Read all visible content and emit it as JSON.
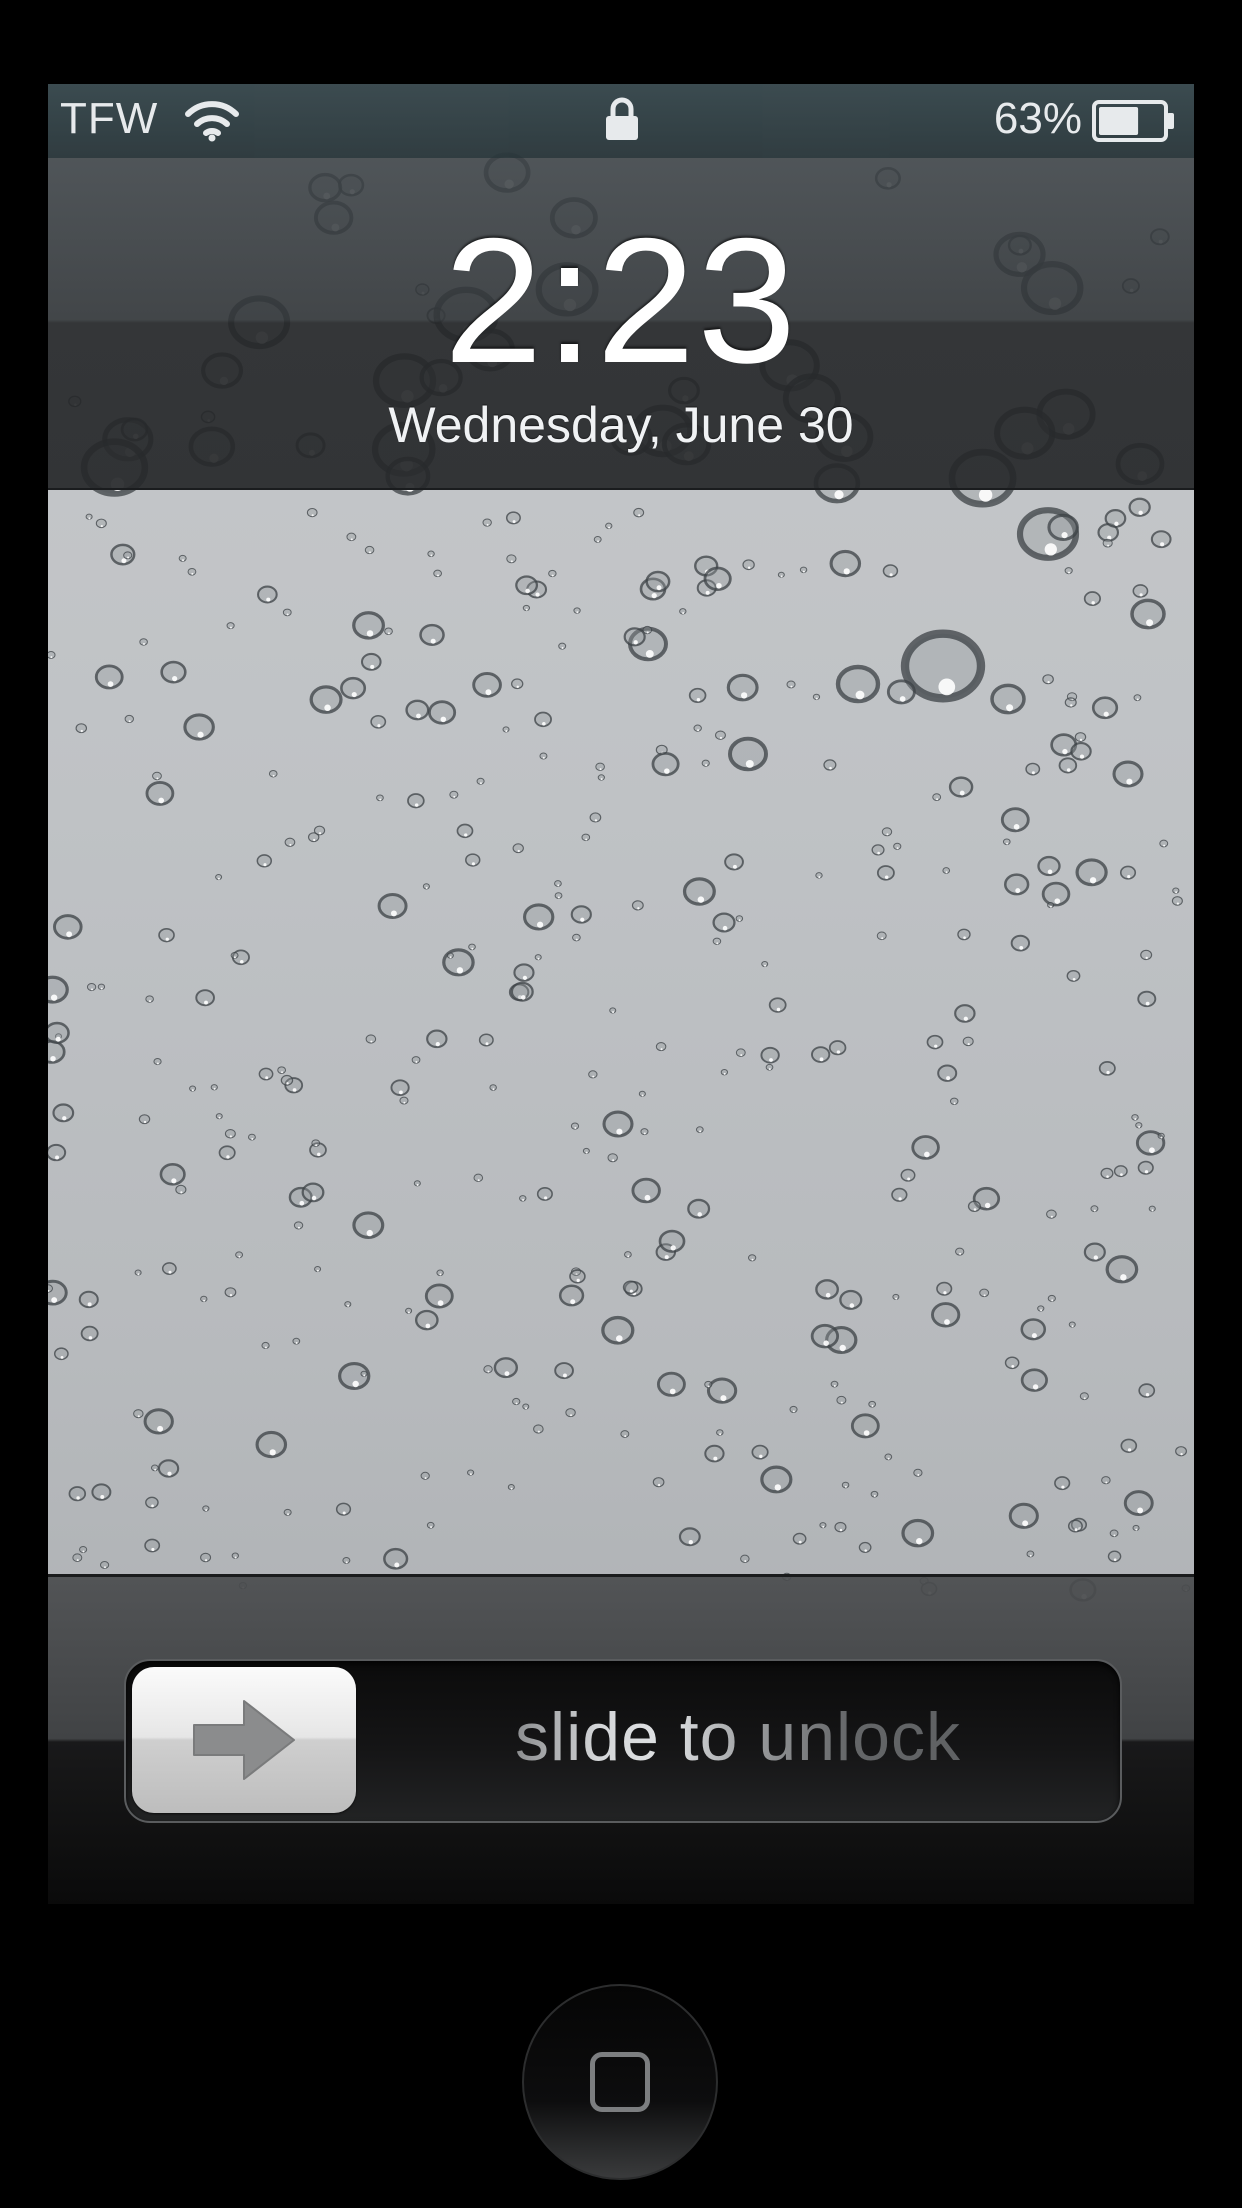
{
  "status_bar": {
    "carrier": "TFW",
    "battery_percent": "63%",
    "battery_level": 0.63,
    "icons": [
      "wifi-icon",
      "lock-icon",
      "battery-icon"
    ]
  },
  "lock_screen": {
    "time": "2:23",
    "date": "Wednesday, June 30"
  },
  "unlock": {
    "label": "slide to unlock",
    "knob_icon": "arrow-right-icon"
  },
  "home_button": {
    "icon": "home-square-icon"
  },
  "colors": {
    "bezel": "#000000",
    "status_bar": "#2f3d41",
    "wallpaper": "#bcbfc2",
    "text": "#ffffff"
  }
}
